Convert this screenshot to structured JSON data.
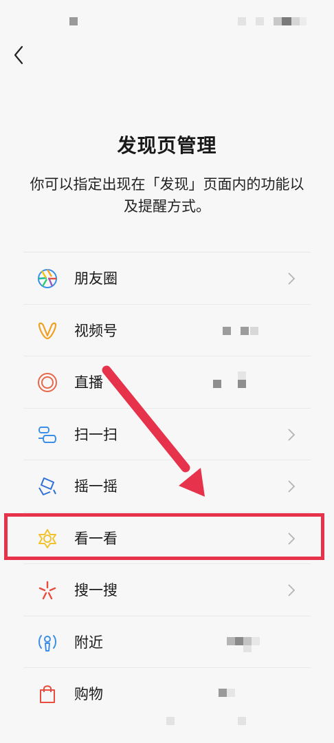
{
  "header": {
    "back_icon": "back-chevron-icon"
  },
  "page": {
    "title": "发现页管理",
    "description": "你可以指定出现在「发现」页面内的功能以及提醒方式。"
  },
  "items": [
    {
      "label": "朋友圈",
      "icon": "moments-icon"
    },
    {
      "label": "视频号",
      "icon": "channels-icon"
    },
    {
      "label": "直播",
      "icon": "live-icon"
    },
    {
      "label": "扫一扫",
      "icon": "scan-icon"
    },
    {
      "label": "摇一摇",
      "icon": "shake-icon"
    },
    {
      "label": "看一看",
      "icon": "top-stories-icon"
    },
    {
      "label": "搜一搜",
      "icon": "search-icon"
    },
    {
      "label": "附近",
      "icon": "nearby-icon"
    },
    {
      "label": "购物",
      "icon": "shopping-icon"
    }
  ],
  "annotation": {
    "highlight_color": "#e6324b"
  }
}
